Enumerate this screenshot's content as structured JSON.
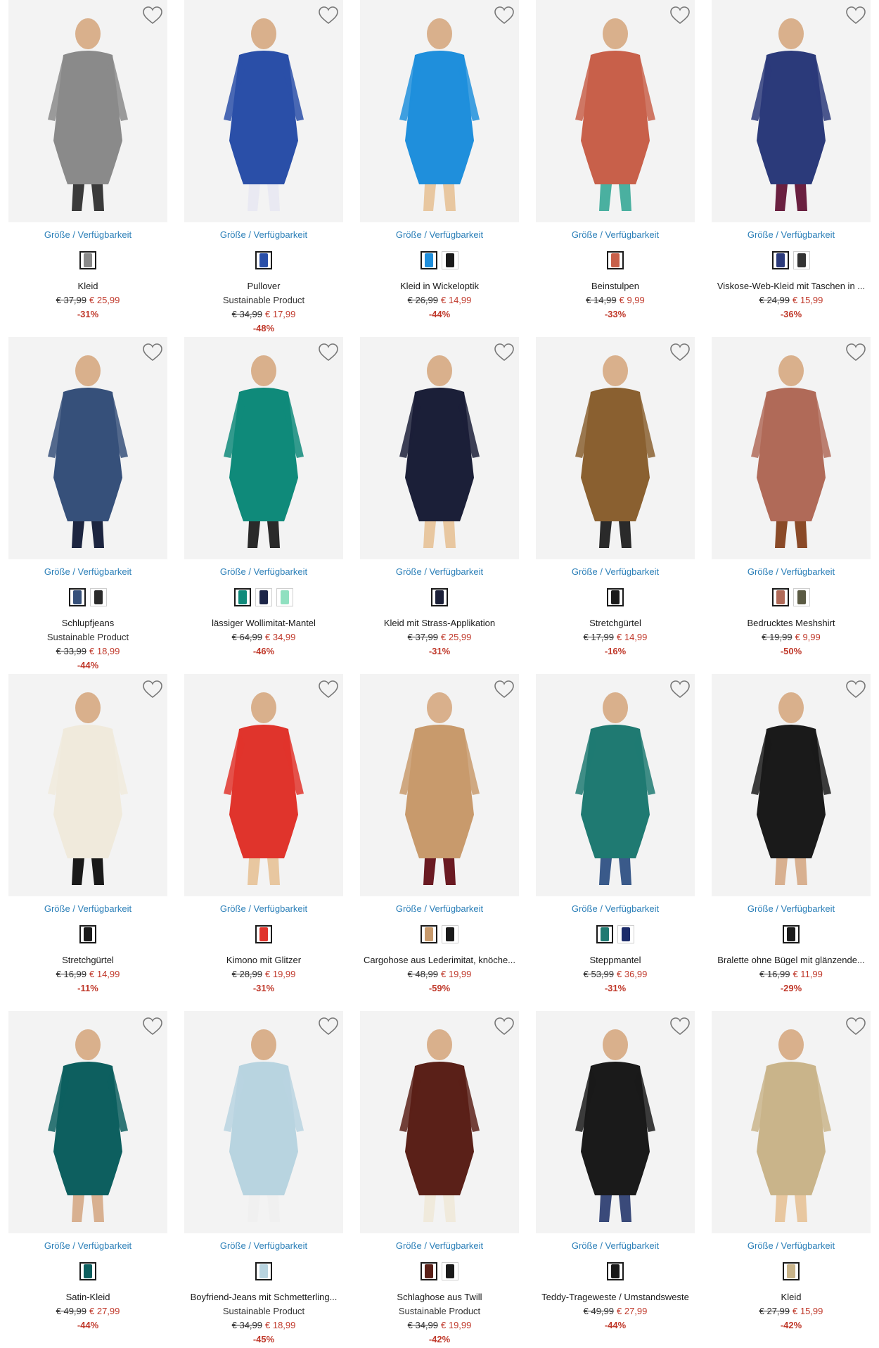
{
  "colors": {
    "link": "#2b7fb8",
    "sale": "#c0392b",
    "text": "#1a1a1a",
    "image_bg": "#efefef"
  },
  "products": [
    {
      "availability": "Größe / Verfügbarkeit",
      "name": "Kleid",
      "subtitle": "",
      "old_price": "€ 37,99",
      "new_price": "€ 25,99",
      "discount": "-31%",
      "swatches": [
        "#8a8a8a"
      ],
      "icon": "heart-icon"
    },
    {
      "availability": "Größe / Verfügbarkeit",
      "name": "Pullover",
      "subtitle": "Sustainable Product",
      "old_price": "€ 34,99",
      "new_price": "€ 17,99",
      "discount": "-48%",
      "swatches": [
        "#2a4fa8"
      ],
      "icon": "heart-icon"
    },
    {
      "availability": "Größe / Verfügbarkeit",
      "name": "Kleid in Wickeloptik",
      "subtitle": "",
      "old_price": "€ 26,99",
      "new_price": "€ 14,99",
      "discount": "-44%",
      "swatches": [
        "#1f8fdc",
        "#1a1a1a"
      ],
      "icon": "heart-icon"
    },
    {
      "availability": "Größe / Verfügbarkeit",
      "name": "Beinstulpen",
      "subtitle": "",
      "old_price": "€ 14,99",
      "new_price": "€ 9,99",
      "discount": "-33%",
      "swatches": [
        "#c8604a"
      ],
      "icon": "heart-icon"
    },
    {
      "availability": "Größe / Verfügbarkeit",
      "name": "Viskose-Web-Kleid mit Taschen in ...",
      "subtitle": "",
      "old_price": "€ 24,99",
      "new_price": "€ 15,99",
      "discount": "-36%",
      "swatches": [
        "#2b3a7a",
        "#333333"
      ],
      "icon": "heart-icon"
    },
    {
      "availability": "Größe / Verfügbarkeit",
      "name": "Schlupfjeans",
      "subtitle": "Sustainable Product",
      "old_price": "€ 33,99",
      "new_price": "€ 18,99",
      "discount": "-44%",
      "swatches": [
        "#36507a",
        "#2a2a2a"
      ],
      "icon": "heart-icon"
    },
    {
      "availability": "Größe / Verfügbarkeit",
      "name": "lässiger Wollimitat-Mantel",
      "subtitle": "",
      "old_price": "€ 64,99",
      "new_price": "€ 34,99",
      "discount": "-46%",
      "swatches": [
        "#0f8a7a",
        "#1c2548",
        "#8fe0c0"
      ],
      "icon": "heart-icon"
    },
    {
      "availability": "Größe / Verfügbarkeit",
      "name": "Kleid mit Strass-Applikation",
      "subtitle": "",
      "old_price": "€ 37,99",
      "new_price": "€ 25,99",
      "discount": "-31%",
      "swatches": [
        "#1b1f38"
      ],
      "icon": "heart-icon"
    },
    {
      "availability": "Größe / Verfügbarkeit",
      "name": "Stretchgürtel",
      "subtitle": "",
      "old_price": "€ 17,99",
      "new_price": "€ 14,99",
      "discount": "-16%",
      "swatches": [
        "#1a1a1a"
      ],
      "icon": "heart-icon"
    },
    {
      "availability": "Größe / Verfügbarkeit",
      "name": "Bedrucktes Meshshirt",
      "subtitle": "",
      "old_price": "€ 19,99",
      "new_price": "€ 9,99",
      "discount": "-50%",
      "swatches": [
        "#b06a58",
        "#5a5a42"
      ],
      "icon": "heart-icon"
    },
    {
      "availability": "Größe / Verfügbarkeit",
      "name": "Stretchgürtel",
      "subtitle": "",
      "old_price": "€ 16,99",
      "new_price": "€ 14,99",
      "discount": "-11%",
      "swatches": [
        "#1a1a1a"
      ],
      "icon": "heart-icon"
    },
    {
      "availability": "Größe / Verfügbarkeit",
      "name": "Kimono mit Glitzer",
      "subtitle": "",
      "old_price": "€ 28,99",
      "new_price": "€ 19,99",
      "discount": "-31%",
      "swatches": [
        "#e0342c"
      ],
      "icon": "heart-icon"
    },
    {
      "availability": "Größe / Verfügbarkeit",
      "name": "Cargohose aus Lederimitat, knöche...",
      "subtitle": "",
      "old_price": "€ 48,99",
      "new_price": "€ 19,99",
      "discount": "-59%",
      "swatches": [
        "#c89a6c",
        "#1a1a1a"
      ],
      "icon": "heart-icon"
    },
    {
      "availability": "Größe / Verfügbarkeit",
      "name": "Steppmantel",
      "subtitle": "",
      "old_price": "€ 53,99",
      "new_price": "€ 36,99",
      "discount": "-31%",
      "swatches": [
        "#1f7a72",
        "#1c2c6a"
      ],
      "icon": "heart-icon"
    },
    {
      "availability": "Größe / Verfügbarkeit",
      "name": "Bralette ohne Bügel mit glänzende...",
      "subtitle": "",
      "old_price": "€ 16,99",
      "new_price": "€ 11,99",
      "discount": "-29%",
      "swatches": [
        "#1a1a1a"
      ],
      "icon": "heart-icon"
    },
    {
      "availability": "Größe / Verfügbarkeit",
      "name": "Satin-Kleid",
      "subtitle": "",
      "old_price": "€ 49,99",
      "new_price": "€ 27,99",
      "discount": "-44%",
      "swatches": [
        "#0d5f5f"
      ],
      "icon": "heart-icon"
    },
    {
      "availability": "Größe / Verfügbarkeit",
      "name": "Boyfriend-Jeans mit Schmetterling...",
      "subtitle": "Sustainable Product",
      "old_price": "€ 34,99",
      "new_price": "€ 18,99",
      "discount": "-45%",
      "swatches": [
        "#b8d4e0"
      ],
      "icon": "heart-icon"
    },
    {
      "availability": "Größe / Verfügbarkeit",
      "name": "Schlaghose aus Twill",
      "subtitle": "Sustainable Product",
      "old_price": "€ 34,99",
      "new_price": "€ 19,99",
      "discount": "-42%",
      "swatches": [
        "#5a2018",
        "#1a1a1a"
      ],
      "icon": "heart-icon"
    },
    {
      "availability": "Größe / Verfügbarkeit",
      "name": "Teddy-Trageweste / Umstandsweste",
      "subtitle": "",
      "old_price": "€ 49,99",
      "new_price": "€ 27,99",
      "discount": "-44%",
      "swatches": [
        "#1a1a1a"
      ],
      "icon": "heart-icon"
    },
    {
      "availability": "Größe / Verfügbarkeit",
      "name": "Kleid",
      "subtitle": "",
      "old_price": "€ 27,99",
      "new_price": "€ 15,99",
      "discount": "-42%",
      "swatches": [
        "#c9b48a"
      ],
      "icon": "heart-icon"
    }
  ]
}
